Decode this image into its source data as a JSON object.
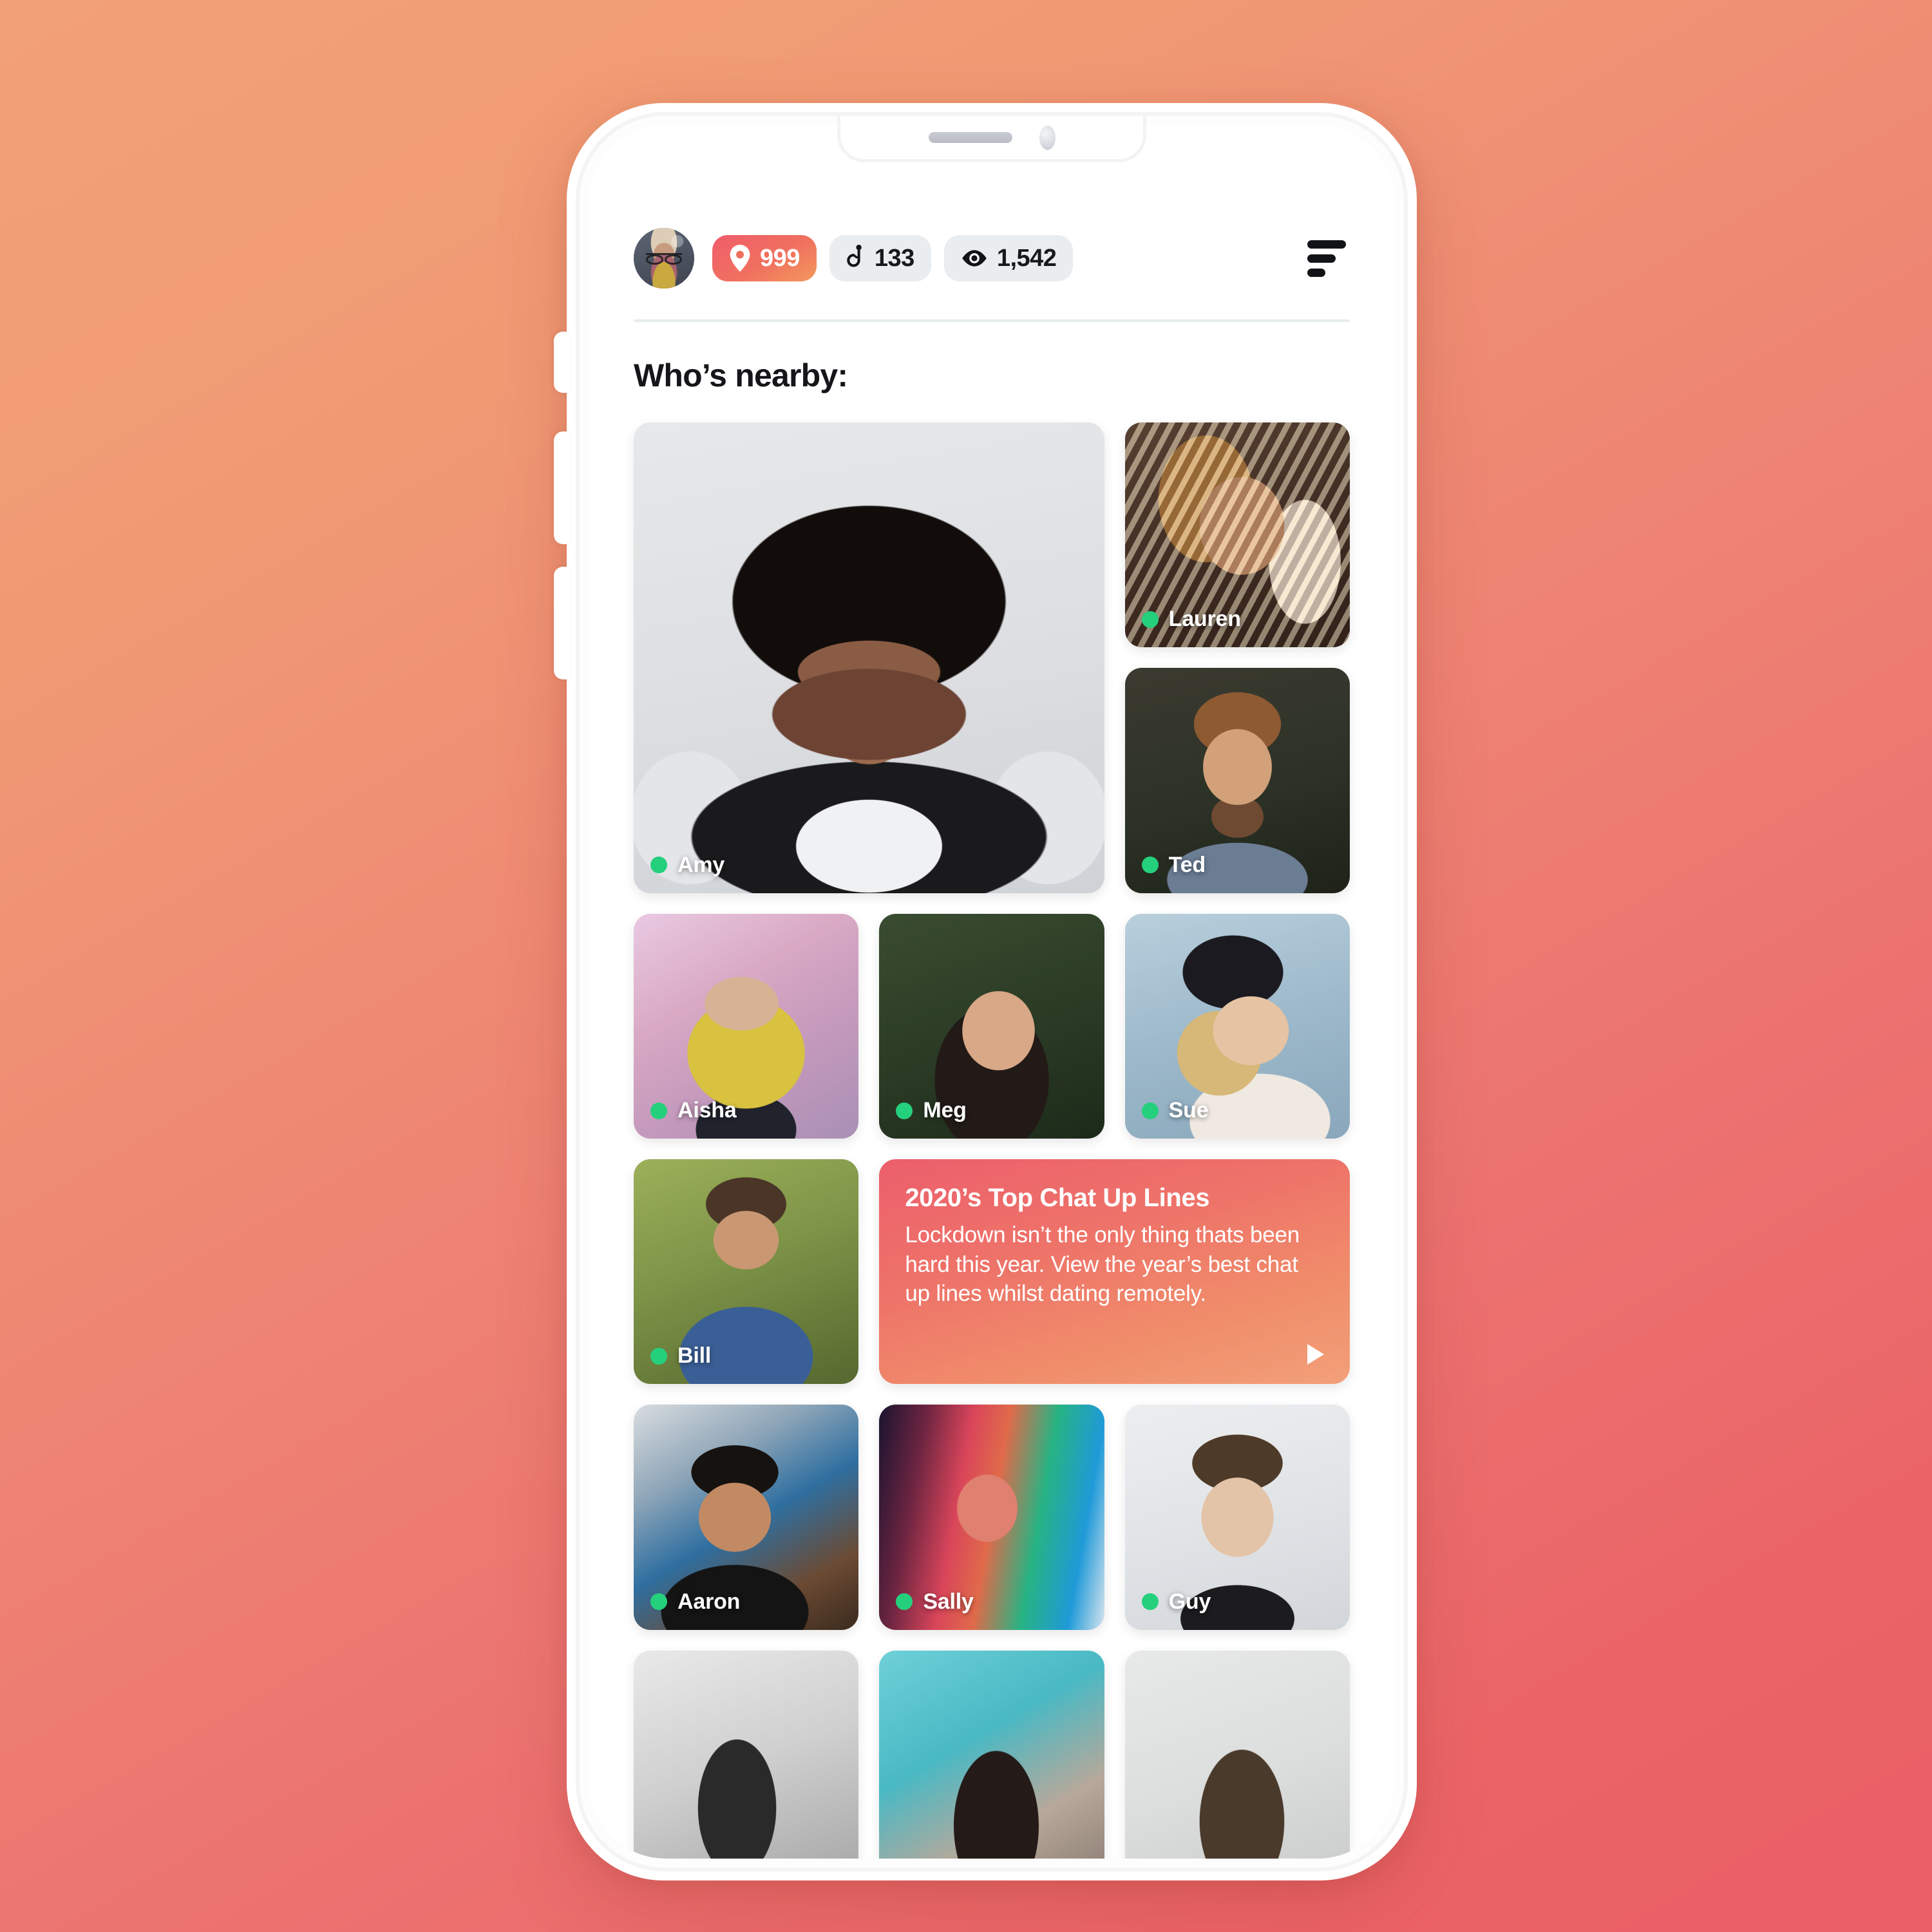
{
  "header": {
    "avatar_name": "user-avatar",
    "stats": [
      {
        "id": "location",
        "icon": "map-pin-icon",
        "value": "999",
        "accent": true
      },
      {
        "id": "hooks",
        "icon": "fish-hook-icon",
        "value": "133",
        "accent": false
      },
      {
        "id": "views",
        "icon": "eye-icon",
        "value": "1,542",
        "accent": false
      }
    ],
    "filter_label": "filter-icon"
  },
  "main": {
    "section_title": "Who’s nearby:",
    "people": [
      {
        "name": "Amy",
        "online": true
      },
      {
        "name": "Lauren",
        "online": true
      },
      {
        "name": "Ted",
        "online": true
      },
      {
        "name": "Aisha",
        "online": true
      },
      {
        "name": "Meg",
        "online": true
      },
      {
        "name": "Sue",
        "online": true
      },
      {
        "name": "Bill",
        "online": true
      },
      {
        "name": "Aaron",
        "online": true
      },
      {
        "name": "Sally",
        "online": true
      },
      {
        "name": "Guy",
        "online": true
      }
    ],
    "promo": {
      "title": "2020’s Top Chat Up Lines",
      "body": "Lockdown isn’t the only thing thats been hard this year. View the year’s best chat up lines whilst dating remotely.",
      "play_label": "play-icon"
    }
  },
  "colors": {
    "background_start": "#F2A077",
    "background_end": "#EA5E65",
    "accent_pill_start": "#EF5D6B",
    "accent_pill_end": "#F3995E",
    "pill_inactive": "#E9EDF0",
    "online_dot": "#25D07D",
    "text_primary": "#15161A",
    "divider": "#E7ECEF"
  }
}
